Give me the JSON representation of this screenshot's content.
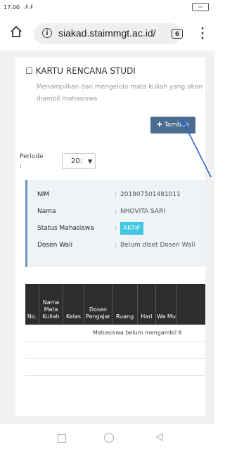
{
  "status": {
    "time": "17.00",
    "signal": "..ıl ..ıl",
    "battery": "ⓓ"
  },
  "browser": {
    "url": "siakad.staimmgt.ac.id/",
    "tab_count": "6"
  },
  "page": {
    "title": "KARTU RENCANA STUDI",
    "description": "Menampilkan dan mengelola mata kuliah yang akan diambil mahasiswa",
    "add_button": "Tambah",
    "periode_label": "Periode :",
    "periode_value": "20:"
  },
  "student": {
    "rows": [
      {
        "label": "NIM",
        "value": "201907501481011"
      },
      {
        "label": "Nama",
        "value": "NHOVITA SARI"
      },
      {
        "label": "Status Mahasiswa",
        "value": "AKTIF"
      },
      {
        "label": "Dosen Wali",
        "value": "Belum diset Dosen Wali"
      }
    ]
  },
  "table": {
    "headers": [
      "No.",
      "Nama Mata Kuliah",
      "Kelas",
      "Dosen Pengajar",
      "Ruang",
      "Hari",
      "Wa Mu"
    ],
    "empty_message": "Mahasiswa belum mengambil K"
  }
}
